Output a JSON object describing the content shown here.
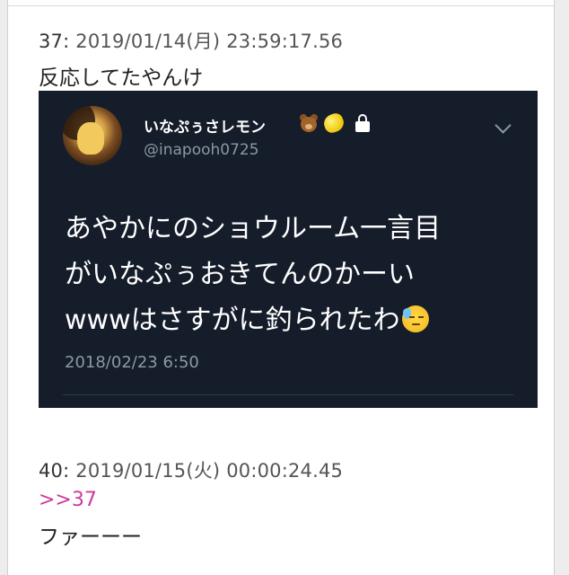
{
  "posts": [
    {
      "number": "37:",
      "meta": "2019/01/14(月) 23:59:17.56",
      "body": "反応してたやんけ"
    },
    {
      "number": "40:",
      "meta": "2019/01/15(火) 00:00:24.45",
      "anchor": ">>37",
      "body": "ファーーー"
    }
  ],
  "tweet": {
    "display_name": "いなぷぅさレモン",
    "name_icons": [
      "bear-icon",
      "lemon-icon",
      "lock-icon"
    ],
    "handle": "@inapooh0725",
    "text_lines": [
      "あやかにのショウルーム一言目",
      "がいなぷぅおきてんのかーい",
      "wwwはさすがに釣られたわ"
    ],
    "text_emoji": "sweat-face-icon",
    "timestamp": "2018/02/23 6:50",
    "background_color": "#151c2a"
  },
  "colors": {
    "anchor": "#cc3b9b",
    "meta_text": "#555555",
    "body_text": "#222222"
  }
}
